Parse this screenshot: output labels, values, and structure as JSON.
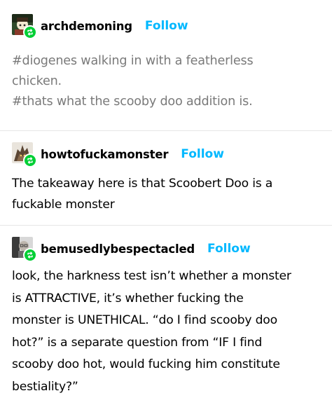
{
  "posts": [
    {
      "username": "archdemoning",
      "follow_label": "Follow",
      "tags": [
        "#diogenes walking in with a featherless",
        "chicken.",
        "#thats what the scooby doo addition is."
      ]
    },
    {
      "username": "howtofuckamonster",
      "follow_label": "Follow",
      "lines": [
        "The takeaway here is that Scoobert Doo is a",
        "fuckable monster"
      ]
    },
    {
      "username": "bemusedlybespectacled",
      "follow_label": "Follow",
      "lines": [
        "look, the harkness test isn’t whether a monster",
        "is ATTRACTIVE, it’s whether fucking the",
        "monster is UNETHICAL. “do I find scooby doo",
        "hot?” is a separate question from “IF I find",
        "scooby doo hot, would fucking him constitute",
        "bestiality?”"
      ]
    }
  ],
  "colors": {
    "follow": "#00b8ff",
    "reblog_badge": "#00cf35",
    "tag_text": "#7a7a7a",
    "divider": "#e6e6e6"
  },
  "icons": {
    "reblog": "reblog-icon"
  }
}
